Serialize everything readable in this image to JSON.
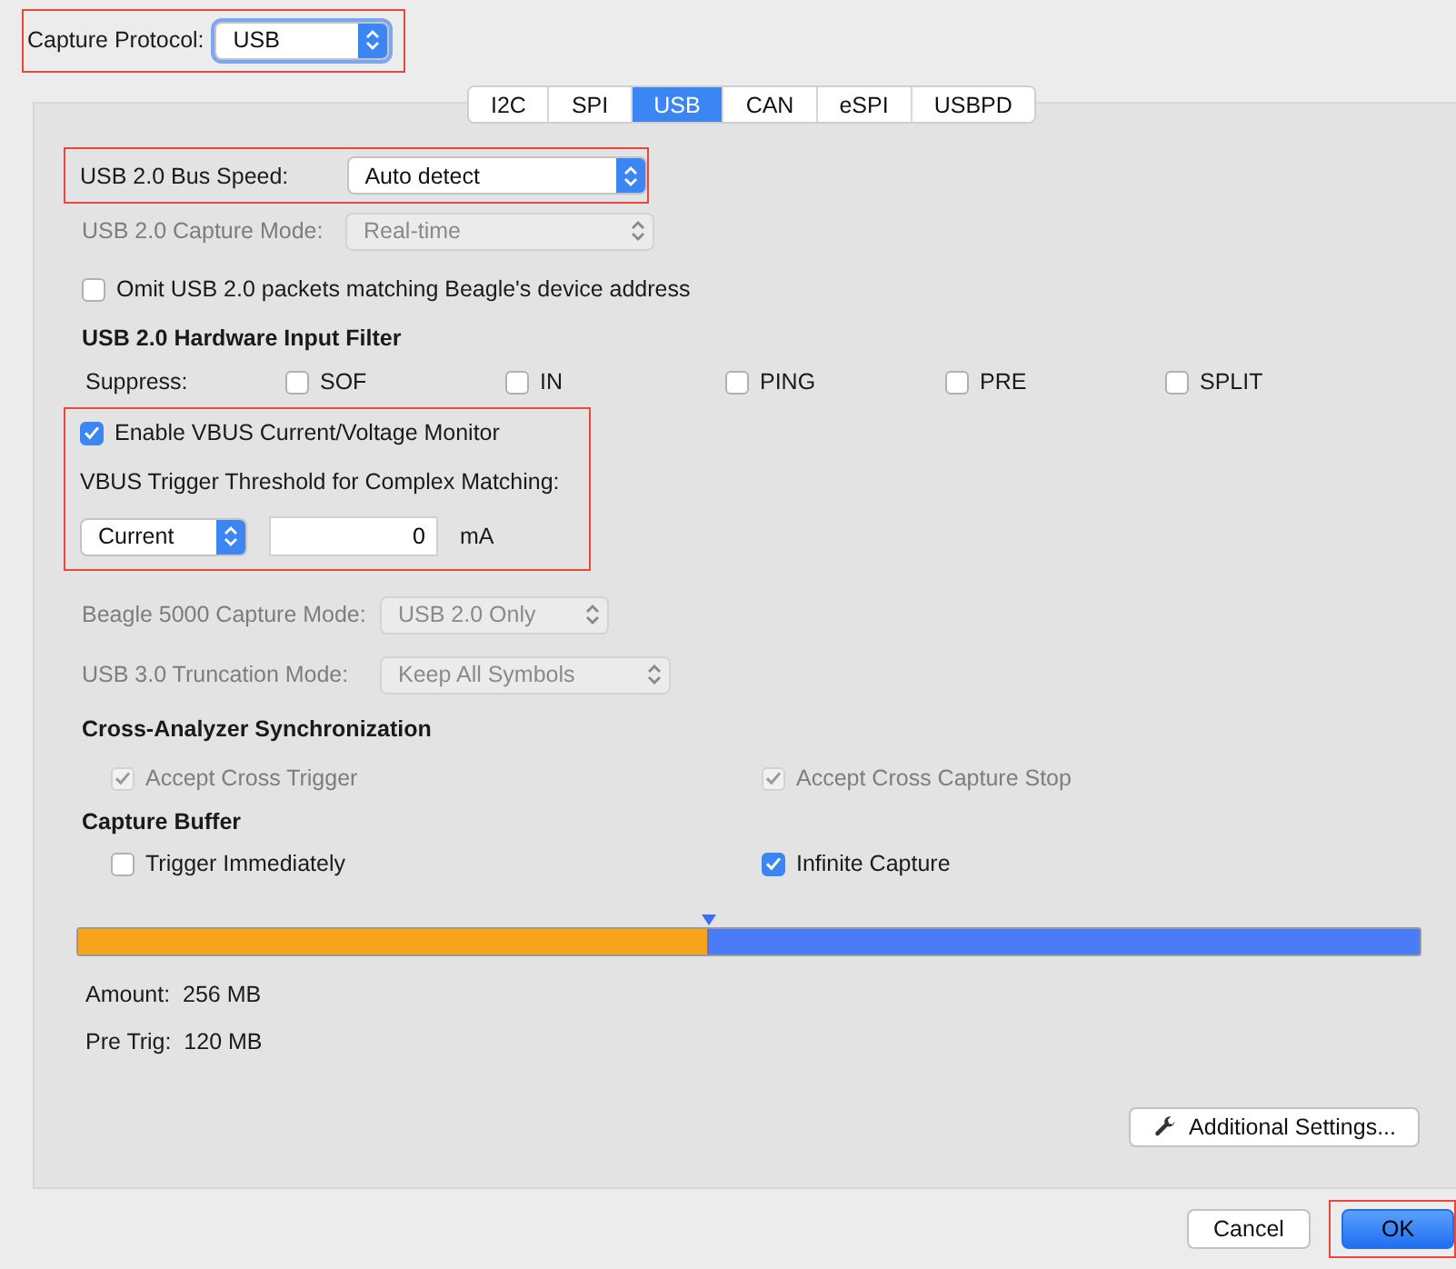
{
  "capture_protocol": {
    "label": "Capture Protocol:",
    "value": "USB",
    "highlighted": true
  },
  "tabs": [
    {
      "label": "I2C",
      "selected": false
    },
    {
      "label": "SPI",
      "selected": false
    },
    {
      "label": "USB",
      "selected": true
    },
    {
      "label": "CAN",
      "selected": false
    },
    {
      "label": "eSPI",
      "selected": false
    },
    {
      "label": "USBPD",
      "selected": false
    }
  ],
  "bus_speed": {
    "label": "USB 2.0 Bus Speed:",
    "value": "Auto detect",
    "disabled": false,
    "highlighted": true
  },
  "capture_mode": {
    "label": "USB 2.0 Capture Mode:",
    "value": "Real-time",
    "disabled": true
  },
  "omit": {
    "label": "Omit USB 2.0 packets matching Beagle's device address",
    "checked": false,
    "disabled": false
  },
  "filter": {
    "title": "USB 2.0 Hardware Input Filter",
    "suppress_label": "Suppress:",
    "options": [
      {
        "label": "SOF",
        "checked": false,
        "disabled": false
      },
      {
        "label": "IN",
        "checked": false,
        "disabled": false
      },
      {
        "label": "PING",
        "checked": false,
        "disabled": false
      },
      {
        "label": "PRE",
        "checked": false,
        "disabled": false
      },
      {
        "label": "SPLIT",
        "checked": false,
        "disabled": false
      }
    ]
  },
  "vbus": {
    "highlighted": true,
    "enable": {
      "label": "Enable VBUS Current/Voltage Monitor",
      "checked": true,
      "disabled": false
    },
    "threshold_label": "VBUS Trigger Threshold for Complex Matching:",
    "type": "Current",
    "value": "0",
    "unit": "mA"
  },
  "beagle_mode": {
    "label": "Beagle 5000 Capture Mode:",
    "value": "USB 2.0 Only",
    "disabled": true
  },
  "truncation": {
    "label": "USB 3.0 Truncation Mode:",
    "value": "Keep All Symbols",
    "disabled": true
  },
  "sync": {
    "title": "Cross-Analyzer Synchronization",
    "options": [
      {
        "label": "Accept Cross Trigger",
        "checked": true,
        "disabled": true
      },
      {
        "label": "Accept Cross Capture Stop",
        "checked": true,
        "disabled": true
      }
    ]
  },
  "buffer": {
    "title": "Capture Buffer",
    "options": [
      {
        "label": "Trigger Immediately",
        "checked": false,
        "disabled": false
      },
      {
        "label": "Infinite Capture",
        "checked": true,
        "disabled": false
      }
    ],
    "level": 0.47,
    "amount": "Amount:  256 MB",
    "pre_trig": "Pre Trig:  120 MB"
  },
  "additional_button": "Additional Settings...",
  "buttons": [
    {
      "label": "Cancel",
      "default": false,
      "highlighted": false
    },
    {
      "label": "OK",
      "default": true,
      "highlighted": true
    }
  ]
}
